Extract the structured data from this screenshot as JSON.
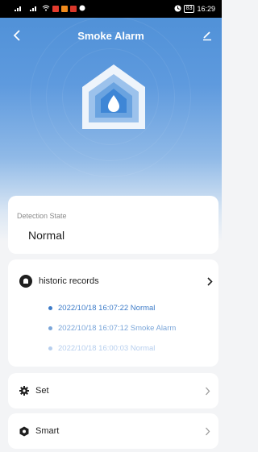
{
  "status_bar": {
    "time": "16:29",
    "battery": "83"
  },
  "header": {
    "title": "Smoke Alarm"
  },
  "detection": {
    "label": "Detection State",
    "value": "Normal"
  },
  "records": {
    "title": "historic records",
    "items": [
      {
        "text": "2022/10/18 16:07:22 Normal",
        "color": "#3c7bc8"
      },
      {
        "text": "2022/10/18 16:07:12 Smoke Alarm",
        "color": "#7ba6d9"
      },
      {
        "text": "2022/10/18 16:00:03 Normal",
        "color": "#b7cfee"
      }
    ]
  },
  "settings": {
    "set_label": "Set",
    "smart_label": "Smart"
  },
  "colors": {
    "accent": "#4d8fd6",
    "header_bg": "#5e9ade"
  }
}
